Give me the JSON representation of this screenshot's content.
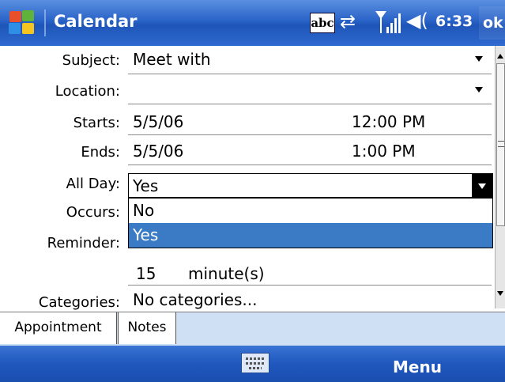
{
  "title_bar": {
    "app_title": "Calendar",
    "input_indicator": "abc",
    "clock": "6:33",
    "ok_label": "ok"
  },
  "form": {
    "subject": {
      "label": "Subject:",
      "value": "Meet with"
    },
    "location": {
      "label": "Location:",
      "value": ""
    },
    "starts": {
      "label": "Starts:",
      "date": "5/5/06",
      "time": "12:00 PM"
    },
    "ends": {
      "label": "Ends:",
      "date": "5/5/06",
      "time": "1:00 PM"
    },
    "all_day": {
      "label": "All Day:",
      "value": "Yes",
      "options": [
        "No",
        "Yes"
      ],
      "highlighted": "Yes"
    },
    "occurs": {
      "label": "Occurs:"
    },
    "reminder": {
      "label": "Reminder:",
      "amount": "15",
      "unit": "minute(s)"
    },
    "categories": {
      "label": "Categories:",
      "value": "No categories..."
    }
  },
  "tabs": [
    {
      "label": "Appointment",
      "active": true
    },
    {
      "label": "Notes",
      "active": false
    }
  ],
  "softkeys": {
    "right": "Menu",
    "center_icon": "keyboard-icon"
  },
  "colors": {
    "title_bar": "#2a63c8",
    "highlight": "#3b7bc6",
    "tab_strip": "#cfe0f5"
  }
}
